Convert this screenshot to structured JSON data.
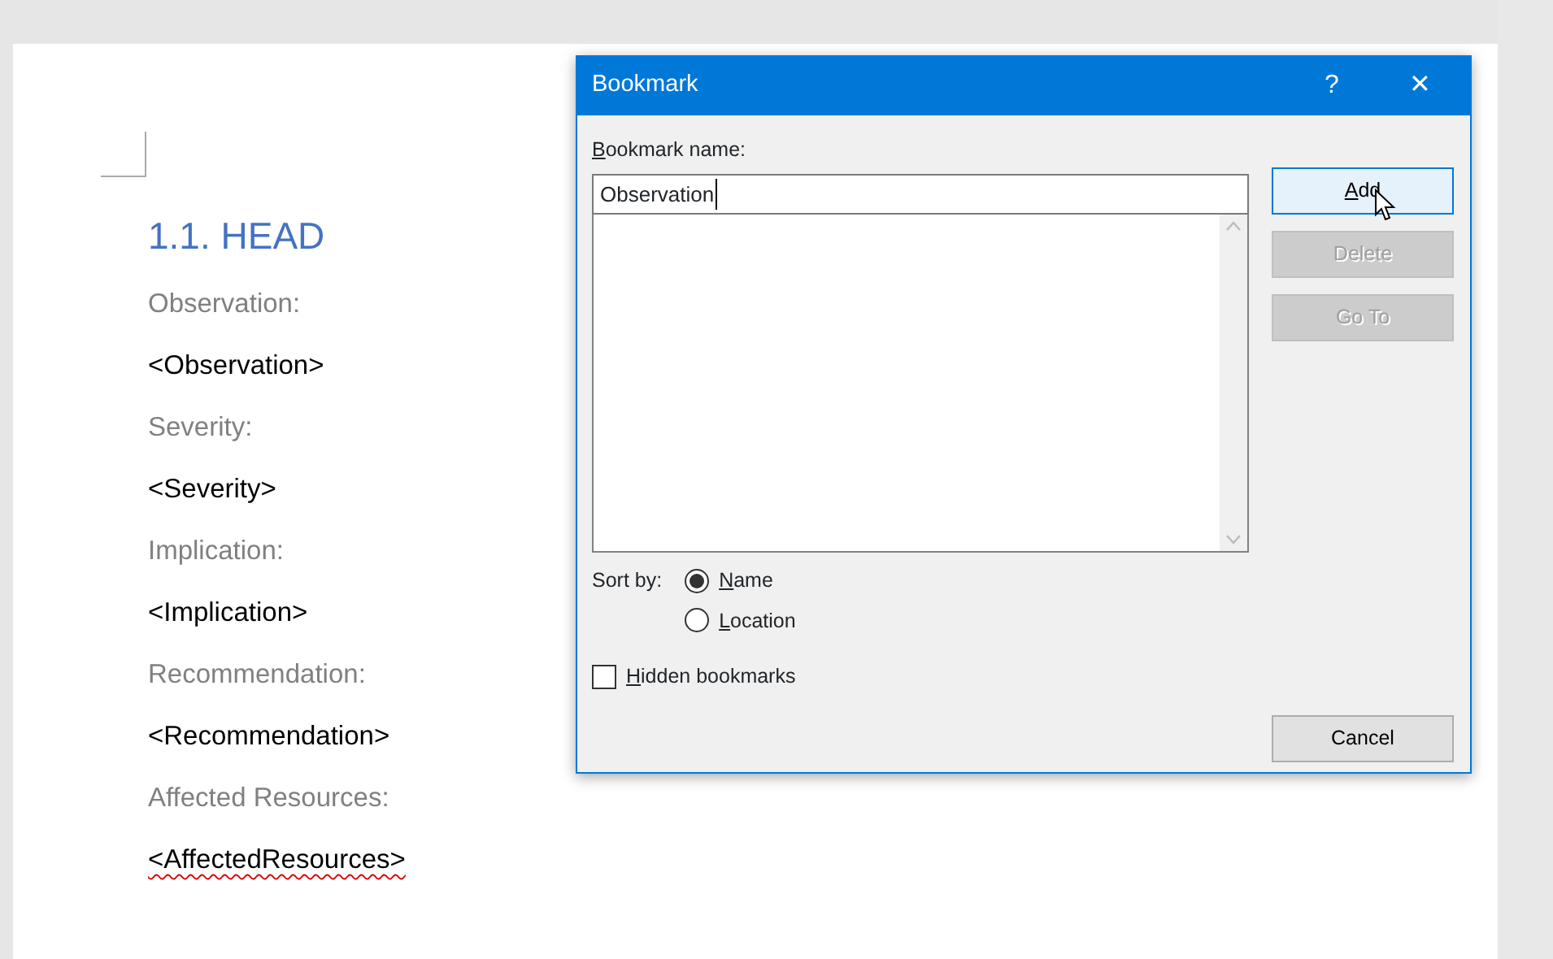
{
  "document": {
    "heading": "1.1.  HEAD",
    "fields": [
      {
        "label": "Observation:",
        "value": "<Observation>",
        "spelling_error": false
      },
      {
        "label": "Severity:",
        "value": "<Severity>",
        "spelling_error": false
      },
      {
        "label": "Implication:",
        "value": "<Implication>",
        "spelling_error": false
      },
      {
        "label": "Recommendation:",
        "value": "<Recommendation>",
        "spelling_error": false
      },
      {
        "label": "Affected Resources:",
        "value": "<AffectedResources>",
        "spelling_error": true
      }
    ]
  },
  "dialog": {
    "title": "Bookmark",
    "help": "?",
    "close": "✕",
    "name_label": "Bookmark name:",
    "name_value": "Observation",
    "buttons": [
      {
        "label": "Add",
        "disabled": false,
        "hovered": true
      },
      {
        "label": "Delete",
        "disabled": true,
        "hovered": false
      },
      {
        "label": "Go To",
        "disabled": true,
        "hovered": false
      }
    ],
    "sort_label": "Sort by:",
    "sort_options": [
      {
        "label": "Name",
        "selected": true
      },
      {
        "label": "Location",
        "selected": false
      }
    ],
    "hidden": {
      "label": "Hidden bookmarks",
      "checked": false
    },
    "cancel": "Cancel"
  }
}
